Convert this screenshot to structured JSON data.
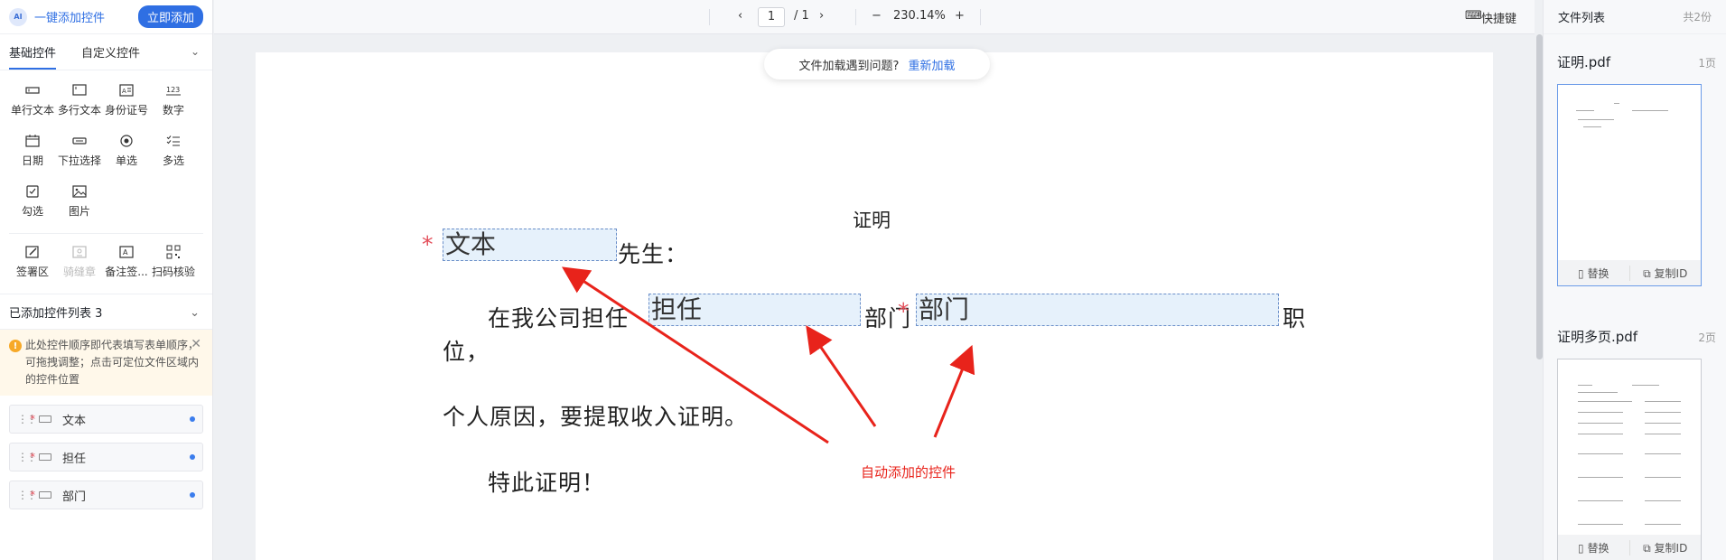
{
  "left_panel": {
    "ai_badge": "AI",
    "one_click_label": "一键添加控件",
    "add_now_button": "立即添加",
    "tabs": [
      {
        "label": "基础控件"
      },
      {
        "label": "自定义控件"
      }
    ],
    "controls": [
      {
        "label": "单行文本",
        "icon": "single-line-text-icon"
      },
      {
        "label": "多行文本",
        "icon": "multi-line-text-icon"
      },
      {
        "label": "身份证号",
        "icon": "id-card-icon"
      },
      {
        "label": "数字",
        "icon": "number-icon"
      },
      {
        "label": "日期",
        "icon": "calendar-icon"
      },
      {
        "label": "下拉选择",
        "icon": "dropdown-icon"
      },
      {
        "label": "单选",
        "icon": "radio-icon"
      },
      {
        "label": "多选",
        "icon": "multi-select-icon"
      },
      {
        "label": "勾选",
        "icon": "checkbox-icon"
      },
      {
        "label": "图片",
        "icon": "image-icon"
      }
    ],
    "sign_controls": [
      {
        "label": "签署区",
        "icon": "sign-area-icon"
      },
      {
        "label": "骑缝章",
        "icon": "seal-icon"
      },
      {
        "label": "备注签...",
        "icon": "note-sign-icon"
      },
      {
        "label": "扫码核验",
        "icon": "qr-scan-icon"
      }
    ],
    "added_list_title": "已添加控件列表 3",
    "notice": "此处控件顺序即代表填写表单顺序，可拖拽调整；点击可定位文件区域内的控件位置",
    "added_items": [
      {
        "label": "文本",
        "required": "*"
      },
      {
        "label": "担任",
        "required": "*"
      },
      {
        "label": "部门",
        "required": "*"
      }
    ]
  },
  "toolbar": {
    "page_current": "1",
    "page_total": "/ 1",
    "zoom": "230.14%",
    "shortcut_label": "快捷键"
  },
  "toast": {
    "message": "文件加载遇到问题?",
    "reload": "重新加载"
  },
  "document": {
    "title": "证明",
    "req_star": "*",
    "field_text": "文本",
    "line1_suffix": "先生：",
    "line2_prefix": "在我公司担任",
    "field_role": "担任",
    "line2_mid": "部门",
    "field_dept": "部门",
    "line2_suffix": "职",
    "line3": "位，",
    "line4": "个人原因，要提取收入证明。",
    "line5": "特此证明！",
    "annotation": "自动添加的控件"
  },
  "right_panel": {
    "title": "文件列表",
    "count": "共2份",
    "files": [
      {
        "name": "证明.pdf",
        "pages": "1页",
        "replace": "替换",
        "copy_id": "复制ID"
      },
      {
        "name": "证明多页.pdf",
        "pages": "2页",
        "replace": "替换",
        "copy_id": "复制ID"
      }
    ]
  },
  "colors": {
    "accent": "#2f6fe3",
    "required": "#e34d59",
    "annotation": "#e8231b"
  }
}
